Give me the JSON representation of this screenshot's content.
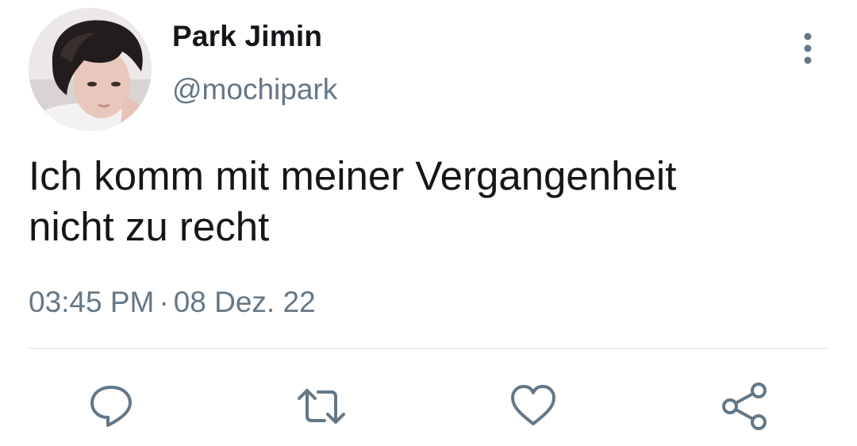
{
  "user": {
    "display_name": "Park Jimin",
    "handle": "@mochipark",
    "avatar_icon": "profile-photo"
  },
  "tweet": {
    "text_line1": "Ich komm mit meiner Vergangenheit",
    "text_line2": "nicht zu recht",
    "time": "03:45 PM",
    "separator": "·",
    "date": "08 Dez. 22"
  },
  "actions": [
    "reply-icon",
    "retweet-icon",
    "like-icon",
    "share-icon"
  ],
  "colors": {
    "text": "#14171a",
    "secondary": "#657786",
    "divider": "#e6ecf0"
  }
}
